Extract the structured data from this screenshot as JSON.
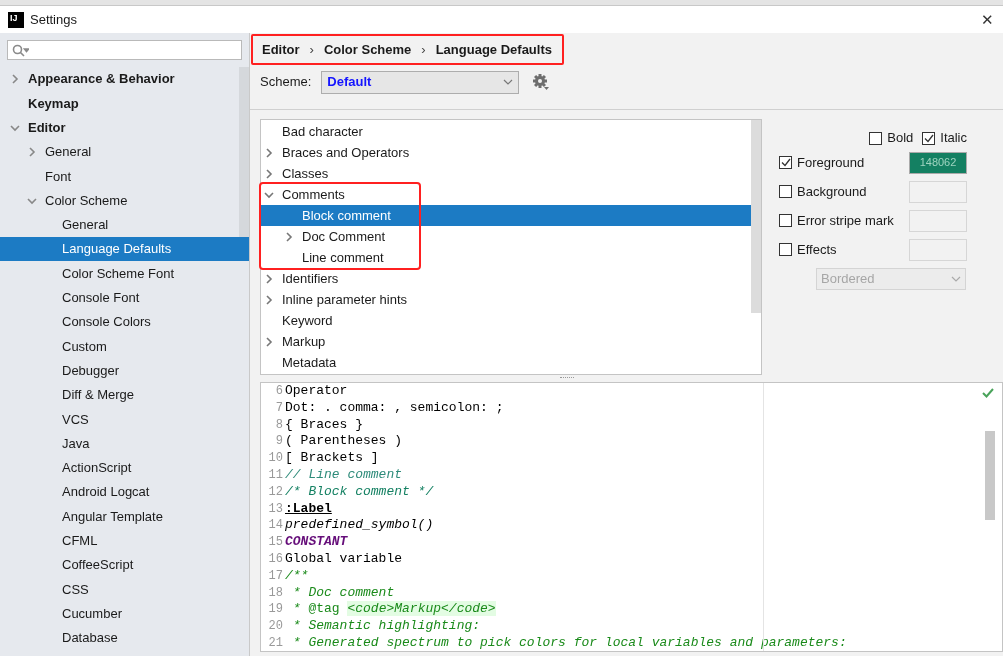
{
  "window": {
    "app_icon_text": "IJ",
    "title": "Settings",
    "close": "✕"
  },
  "sidebar": {
    "items": [
      {
        "label": "Appearance & Behavior",
        "expanded": false,
        "selected": false
      },
      {
        "label": "Keymap",
        "selected": false
      },
      {
        "label": "Editor",
        "expanded": true,
        "selected": false,
        "children": [
          {
            "label": "General",
            "expanded": false,
            "selected": false
          },
          {
            "label": "Font",
            "selected": false
          },
          {
            "label": "Color Scheme",
            "expanded": true,
            "selected": false,
            "children": [
              {
                "label": "General",
                "selected": false
              },
              {
                "label": "Language Defaults",
                "selected": true
              },
              {
                "label": "Color Scheme Font",
                "selected": false
              },
              {
                "label": "Console Font",
                "selected": false
              },
              {
                "label": "Console Colors",
                "selected": false
              },
              {
                "label": "Custom",
                "selected": false
              },
              {
                "label": "Debugger",
                "selected": false
              },
              {
                "label": "Diff & Merge",
                "selected": false
              },
              {
                "label": "VCS",
                "selected": false
              },
              {
                "label": "Java",
                "selected": false
              },
              {
                "label": "ActionScript",
                "selected": false
              },
              {
                "label": "Android Logcat",
                "selected": false
              },
              {
                "label": "Angular Template",
                "selected": false
              },
              {
                "label": "CFML",
                "selected": false
              },
              {
                "label": "CoffeeScript",
                "selected": false
              },
              {
                "label": "CSS",
                "selected": false
              },
              {
                "label": "Cucumber",
                "selected": false
              },
              {
                "label": "Database",
                "selected": false
              }
            ]
          }
        ]
      }
    ]
  },
  "breadcrumb": {
    "annotation_frame": true,
    "items": [
      "Editor",
      "Color Scheme",
      "Language Defaults"
    ],
    "separators": [
      "›",
      "›"
    ]
  },
  "scheme": {
    "label": "Scheme:",
    "value": "Default"
  },
  "attributes": [
    {
      "label": "Bad character",
      "selected": false
    },
    {
      "label": "Braces and Operators",
      "expanded": false,
      "selected": false
    },
    {
      "label": "Classes",
      "expanded": false,
      "selected": false
    },
    {
      "label": "Comments",
      "expanded": true,
      "selected": false,
      "annotation_frame": true,
      "children": [
        {
          "label": "Block comment",
          "selected": true
        },
        {
          "label": "Doc Comment",
          "expanded": false,
          "selected": false
        },
        {
          "label": "Line comment",
          "selected": false
        }
      ]
    },
    {
      "label": "Identifiers",
      "expanded": false,
      "selected": false
    },
    {
      "label": "Inline parameter hints",
      "expanded": false,
      "selected": false
    },
    {
      "label": "Keyword",
      "selected": false
    },
    {
      "label": "Markup",
      "expanded": false,
      "selected": false
    },
    {
      "label": "Metadata",
      "selected": false
    }
  ],
  "options": {
    "bold": {
      "label": "Bold",
      "checked": false
    },
    "italic": {
      "label": "Italic",
      "checked": true
    },
    "rows": [
      {
        "label": "Foreground",
        "checked": true,
        "color": "#148062",
        "value": "148062"
      },
      {
        "label": "Background",
        "checked": false
      },
      {
        "label": "Error stripe mark",
        "checked": false
      },
      {
        "label": "Effects",
        "checked": false
      }
    ],
    "effect_type": {
      "value": "Bordered",
      "disabled": true
    }
  },
  "preview": {
    "lines": [
      {
        "number": "6",
        "segments": [
          {
            "text": "Operator",
            "kind": "plain"
          }
        ]
      },
      {
        "number": "7",
        "segments": [
          {
            "text": "Dot: . comma: , semicolon: ;",
            "kind": "plain"
          }
        ]
      },
      {
        "number": "8",
        "segments": [
          {
            "text": "{ Braces }",
            "kind": "plain"
          }
        ]
      },
      {
        "number": "9",
        "segments": [
          {
            "text": "( Parentheses )",
            "kind": "plain"
          }
        ]
      },
      {
        "number": "10",
        "segments": [
          {
            "text": "[ Brackets ]",
            "kind": "plain"
          }
        ]
      },
      {
        "number": "11",
        "segments": [
          {
            "text": "// Line comment",
            "kind": "line_comment"
          }
        ]
      },
      {
        "number": "12",
        "segments": [
          {
            "text": "/* Block comment */",
            "kind": "block_comment"
          }
        ]
      },
      {
        "number": "13",
        "segments": [
          {
            "text": ":Label",
            "kind": "label"
          }
        ]
      },
      {
        "number": "14",
        "segments": [
          {
            "text": "predefined_symbol()",
            "kind": "predefined"
          }
        ]
      },
      {
        "number": "15",
        "segments": [
          {
            "text": "CONSTANT",
            "kind": "constant"
          }
        ]
      },
      {
        "number": "16",
        "segments": [
          {
            "text": "Global variable",
            "kind": "plain"
          }
        ]
      },
      {
        "number": "17",
        "segments": [
          {
            "text": "/**",
            "kind": "doc"
          }
        ]
      },
      {
        "number": "18",
        "segments": [
          {
            "text": " * Doc comment",
            "kind": "doc"
          }
        ]
      },
      {
        "number": "19",
        "segments": [
          {
            "text": " * ",
            "kind": "doc"
          },
          {
            "text": "@tag ",
            "kind": "doc_tag"
          },
          {
            "text": "<code>Markup</code>",
            "kind": "markup"
          }
        ]
      },
      {
        "number": "20",
        "segments": [
          {
            "text": " * Semantic highlighting:",
            "kind": "doc"
          }
        ]
      },
      {
        "number": "21",
        "segments": [
          {
            "text": " * Generated spectrum to pick colors for local variables and parameters:",
            "kind": "doc"
          }
        ]
      }
    ]
  }
}
